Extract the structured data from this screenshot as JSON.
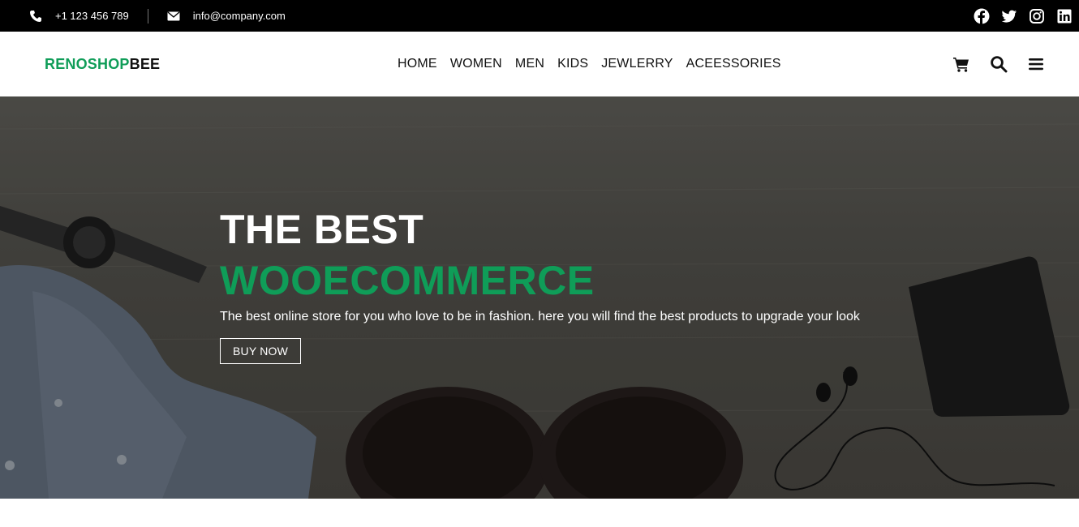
{
  "topbar": {
    "phone": "+1 123 456 789",
    "email": "info@company.com",
    "social": [
      {
        "icon": "facebook-icon"
      },
      {
        "icon": "twitter-icon"
      },
      {
        "icon": "instagram-icon"
      },
      {
        "icon": "linkedin-icon"
      }
    ]
  },
  "brand": {
    "part1": "RENOSHOP",
    "part2": "BEE",
    "accent": "#0f9d58"
  },
  "nav": {
    "items": [
      "HOME",
      "WOMEN",
      "MEN",
      "KIDS",
      "JEWLERRY",
      "ACEESSORIES"
    ],
    "icons": [
      "cart-icon",
      "search-icon",
      "menu-icon"
    ]
  },
  "hero": {
    "title_line1": "THE BEST",
    "title_line2": "WOOECOMMERCE",
    "description": "The best online store for you who love to be in fashion. here you will find the best products to upgrade your look",
    "button": "BUY NOW"
  }
}
